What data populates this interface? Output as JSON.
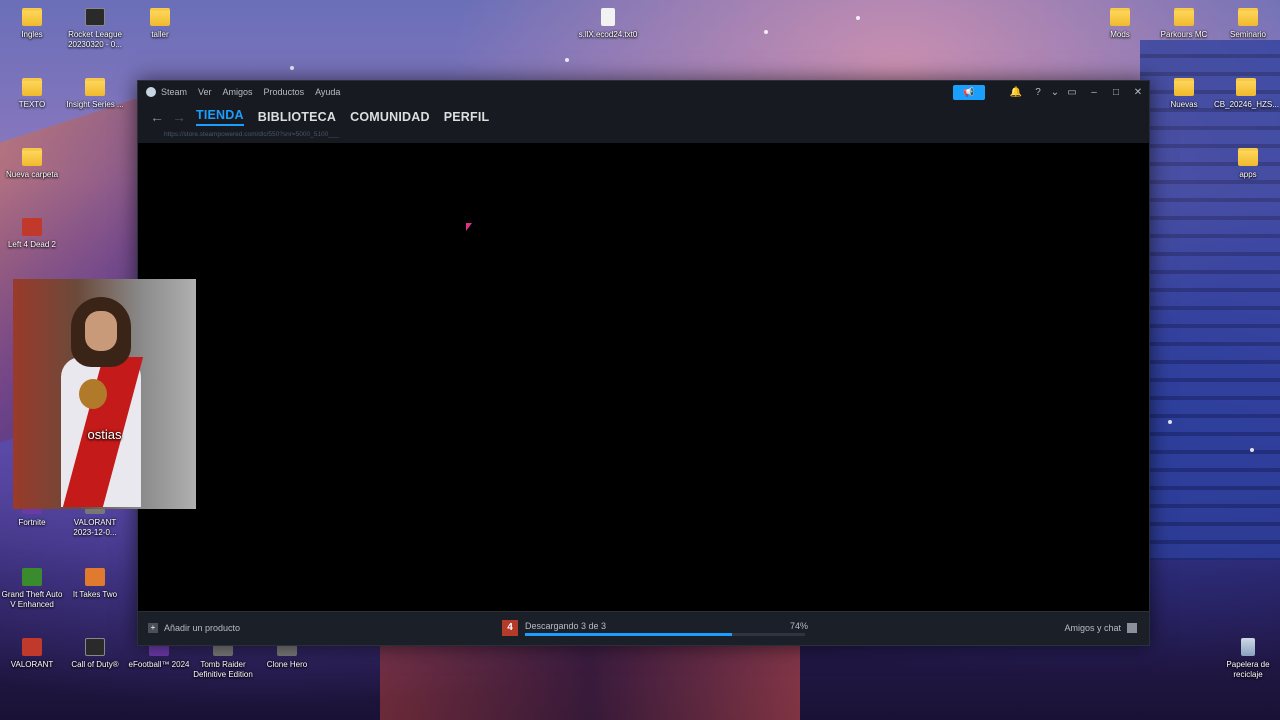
{
  "desktop": {
    "icons": [
      {
        "label": "Ingles",
        "kind": "folder",
        "x": 0
      },
      {
        "label": "Rocket League 20230320 - 0...",
        "kind": "app"
      },
      {
        "label": "taller",
        "kind": "folder"
      },
      {
        "label": "s.llX.ecod24.txt0",
        "kind": "file"
      },
      {
        "label": "Mods",
        "kind": "folder"
      },
      {
        "label": "Parkours MC",
        "kind": "folder"
      },
      {
        "label": "Seminario",
        "kind": "folder"
      },
      {
        "label": "TEXTO",
        "kind": "folder"
      },
      {
        "label": "Insight Series ...",
        "kind": "folder"
      },
      {
        "label": "Nuevas",
        "kind": "folder"
      },
      {
        "label": "CB_20246_HZS...",
        "kind": "folder"
      },
      {
        "label": "Nueva carpeta",
        "kind": "folder"
      },
      {
        "label": "apps",
        "kind": "folder"
      },
      {
        "label": "Left 4 Dead 2",
        "kind": "app"
      },
      {
        "label": "Fortnite",
        "kind": "app"
      },
      {
        "label": "VALORANT 2023-12-0...",
        "kind": "app"
      },
      {
        "label": "Grand Theft Auto V Enhanced",
        "kind": "app"
      },
      {
        "label": "It Takes Two",
        "kind": "app"
      },
      {
        "label": "VALORANT",
        "kind": "app"
      },
      {
        "label": "Call of Duty®",
        "kind": "app"
      },
      {
        "label": "eFootball™ 2024",
        "kind": "app"
      },
      {
        "label": "Tomb Raider Definitive Edition",
        "kind": "app"
      },
      {
        "label": "Clone Hero",
        "kind": "app"
      },
      {
        "label": "Papelera de reciclaje",
        "kind": "trash"
      }
    ]
  },
  "steam": {
    "title": "Steam",
    "menus": [
      "Ver",
      "Amigos",
      "Productos",
      "Ayuda"
    ],
    "nav": [
      "TIENDA",
      "BIBLIOTECA",
      "COMUNIDAD",
      "PERFIL"
    ],
    "url": "https://store.steampowered.com/dlc/550?snr=5000_5100___",
    "bottom": {
      "add_product": "Añadir un producto",
      "download_status": "Descargando 3 de 3",
      "download_percent": "74%",
      "download_progress": 0.74,
      "friends": "Amigos y chat"
    }
  },
  "overlay": {
    "caption": "ostias"
  }
}
